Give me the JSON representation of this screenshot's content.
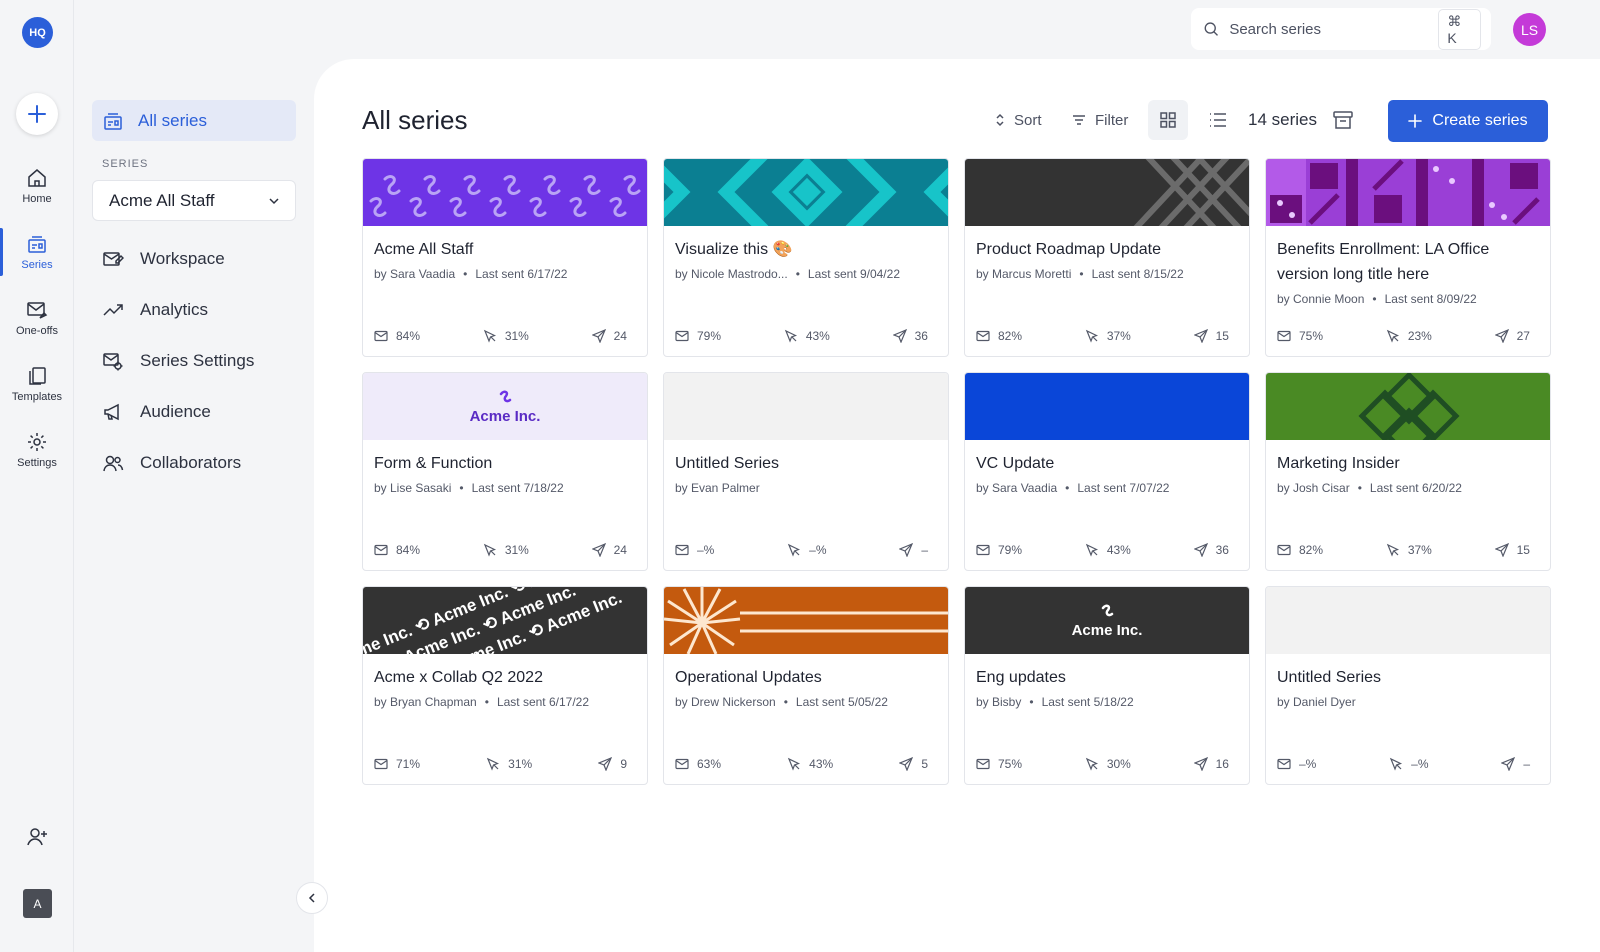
{
  "app": {
    "logo_text": "HQ"
  },
  "rail": {
    "items": [
      {
        "label": "Home"
      },
      {
        "label": "Series"
      },
      {
        "label": "One-offs"
      },
      {
        "label": "Templates"
      },
      {
        "label": "Settings"
      }
    ],
    "avatar_initial": "A"
  },
  "sidebar": {
    "all_series": "All series",
    "section_label": "SERIES",
    "selected_series": "Acme All Staff",
    "links": [
      {
        "label": "Workspace"
      },
      {
        "label": "Analytics"
      },
      {
        "label": "Series Settings"
      },
      {
        "label": "Audience"
      },
      {
        "label": "Collaborators"
      }
    ]
  },
  "topbar": {
    "search_placeholder": "Search series",
    "shortcut": "⌘ K",
    "user_initials": "LS"
  },
  "main": {
    "title": "All series",
    "sort_label": "Sort",
    "filter_label": "Filter",
    "count_label": "14 series",
    "create_label": "Create series"
  },
  "cards": [
    {
      "title": "Acme All Staff",
      "author": "by Sara Vaadia",
      "last_sent": "Last sent 6/17/22",
      "open": "84%",
      "click": "31%",
      "sent": "24"
    },
    {
      "title": "Visualize this 🎨",
      "author": "by Nicole Mastrodo...",
      "last_sent": "Last sent 9/04/22",
      "open": "79%",
      "click": "43%",
      "sent": "36"
    },
    {
      "title": "Product Roadmap Update",
      "author": "by Marcus Moretti",
      "last_sent": "Last sent 8/15/22",
      "open": "82%",
      "click": "37%",
      "sent": "15"
    },
    {
      "title": "Benefits Enrollment: LA Office version long title here",
      "author": "by Connie Moon",
      "last_sent": "Last sent 8/09/22",
      "open": "75%",
      "click": "23%",
      "sent": "27"
    },
    {
      "title": "Form & Function",
      "author": "by Lise Sasaki",
      "last_sent": "Last sent 7/18/22",
      "open": "84%",
      "click": "31%",
      "sent": "24",
      "banner_text": "Acme Inc."
    },
    {
      "title": "Untitled Series",
      "author": "by Evan Palmer",
      "last_sent": "",
      "open": "–%",
      "click": "–%",
      "sent": "–"
    },
    {
      "title": "VC Update",
      "author": "by Sara Vaadia",
      "last_sent": "Last sent 7/07/22",
      "open": "79%",
      "click": "43%",
      "sent": "36"
    },
    {
      "title": "Marketing Insider",
      "author": "by Josh Cisar",
      "last_sent": "Last sent 6/20/22",
      "open": "82%",
      "click": "37%",
      "sent": "15"
    },
    {
      "title": "Acme x Collab Q2 2022",
      "author": "by Bryan Chapman",
      "last_sent": "Last sent 6/17/22",
      "open": "71%",
      "click": "31%",
      "sent": "9",
      "banner_text": "Acme Inc."
    },
    {
      "title": "Operational Updates",
      "author": "by Drew Nickerson",
      "last_sent": "Last sent 5/05/22",
      "open": "63%",
      "click": "43%",
      "sent": "5"
    },
    {
      "title": "Eng updates",
      "author": "by Bisby",
      "last_sent": "Last sent 5/18/22",
      "open": "75%",
      "click": "30%",
      "sent": "16",
      "banner_text": "Acme Inc."
    },
    {
      "title": "Untitled Series",
      "author": "by Daniel Dyer",
      "last_sent": "",
      "open": "–%",
      "click": "–%",
      "sent": "–"
    }
  ],
  "colors": {
    "accent": "#2b5fd9",
    "avatar": "#c43ad8",
    "purple": "#6e34e6",
    "teal": "#0b7f92",
    "dark": "#333333",
    "magenta": "#9a3fd6",
    "lavender": "#efebfa",
    "gray": "#f2f2f2",
    "blue": "#0a46d8",
    "green": "#4a8a24",
    "orange": "#c45a0e"
  }
}
